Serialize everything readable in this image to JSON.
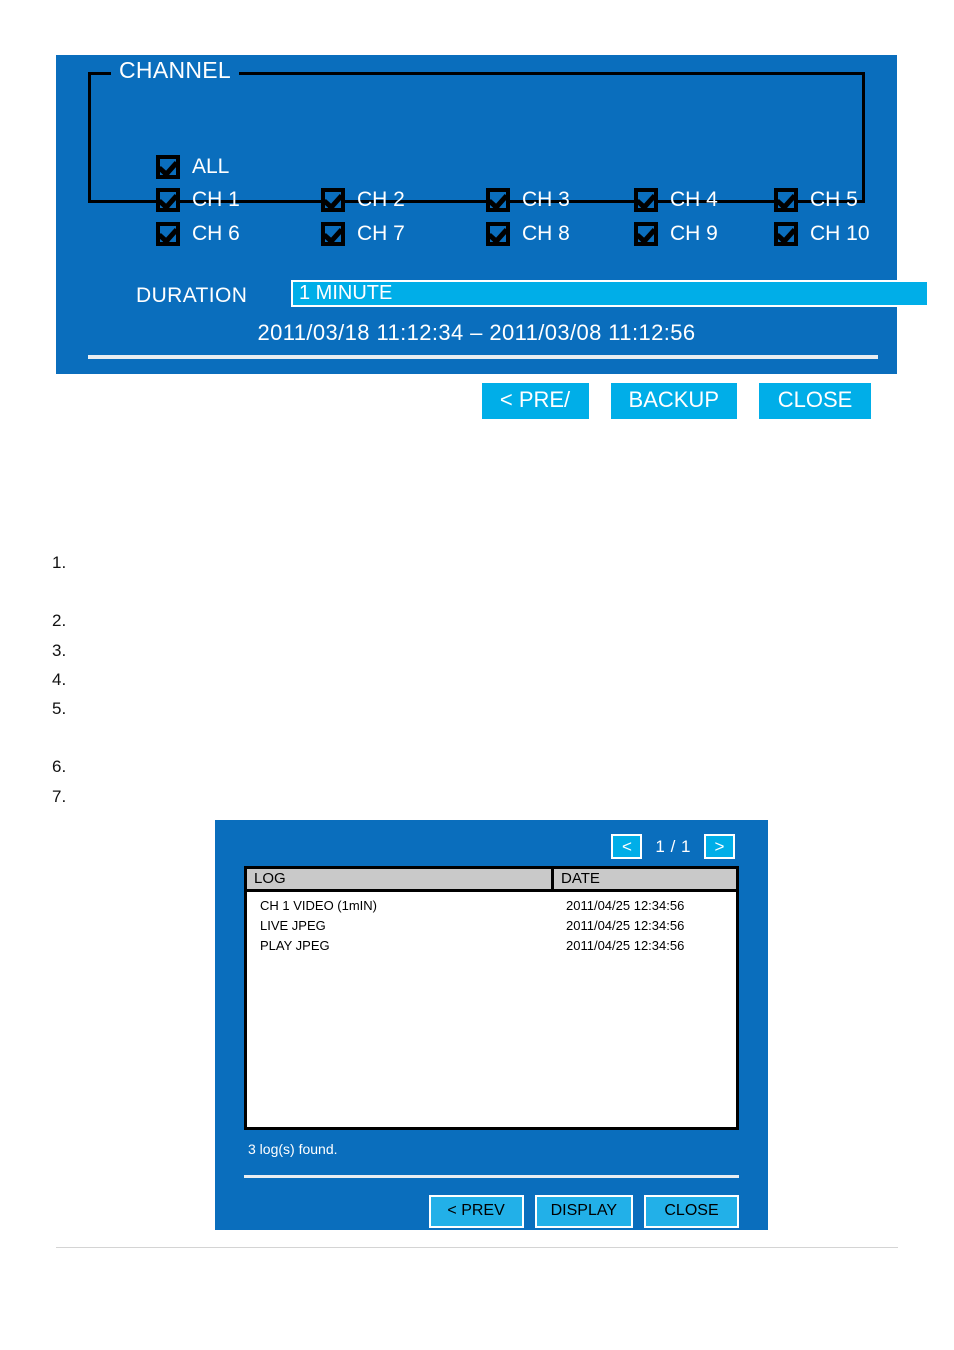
{
  "backup_dialog": {
    "channel_group": {
      "legend": "CHANNEL",
      "all": {
        "label": "ALL",
        "checked": true
      },
      "channels": [
        {
          "label": "CH 1",
          "checked": true
        },
        {
          "label": "CH 2",
          "checked": true
        },
        {
          "label": "CH 3",
          "checked": true
        },
        {
          "label": "CH 4",
          "checked": true
        },
        {
          "label": "CH 5",
          "checked": true
        },
        {
          "label": "CH 6",
          "checked": true
        },
        {
          "label": "CH 7",
          "checked": true
        },
        {
          "label": "CH 8",
          "checked": true
        },
        {
          "label": "CH 9",
          "checked": true
        },
        {
          "label": "CH 10",
          "checked": true
        }
      ]
    },
    "duration": {
      "label": "DURATION",
      "value": "1 MINUTE"
    },
    "date_range": {
      "start": "2011/03/18  11:12:34",
      "separator": "–",
      "end": "2011/03/08  11:12:56",
      "full": "2011/03/18  11:12:34 – 2011/03/08  11:12:56"
    },
    "buttons": {
      "prev": "< PRE/",
      "backup": "BACKUP",
      "close": "CLOSE"
    }
  },
  "numbered_list": [
    {
      "marker": "1."
    },
    {
      "marker": "2."
    },
    {
      "marker": "3."
    },
    {
      "marker": "4."
    },
    {
      "marker": "5."
    },
    {
      "marker": "6."
    },
    {
      "marker": "7."
    }
  ],
  "log_dialog": {
    "pager": {
      "prev_icon": "<",
      "next_icon": ">",
      "page_text": "1 / 1"
    },
    "table": {
      "headers": [
        "LOG",
        "DATE"
      ],
      "rows": [
        {
          "log": "CH 1    VIDEO (1mIN)",
          "date": "2011/04/25  12:34:56"
        },
        {
          "log": "LIVE JPEG",
          "date": "2011/04/25  12:34:56"
        },
        {
          "log": "PLAY JPEG",
          "date": "2011/04/25  12:34:56"
        }
      ]
    },
    "status": "3 log(s) found.",
    "buttons": {
      "prev": "< PREV",
      "display": "DISPLAY",
      "close": "CLOSE"
    }
  },
  "colors": {
    "panel_blue": "#0A6EBD",
    "accent_cyan": "#00AEE8",
    "header_gray": "#C9C9C9",
    "white": "#FFFFFF",
    "black": "#000000"
  }
}
